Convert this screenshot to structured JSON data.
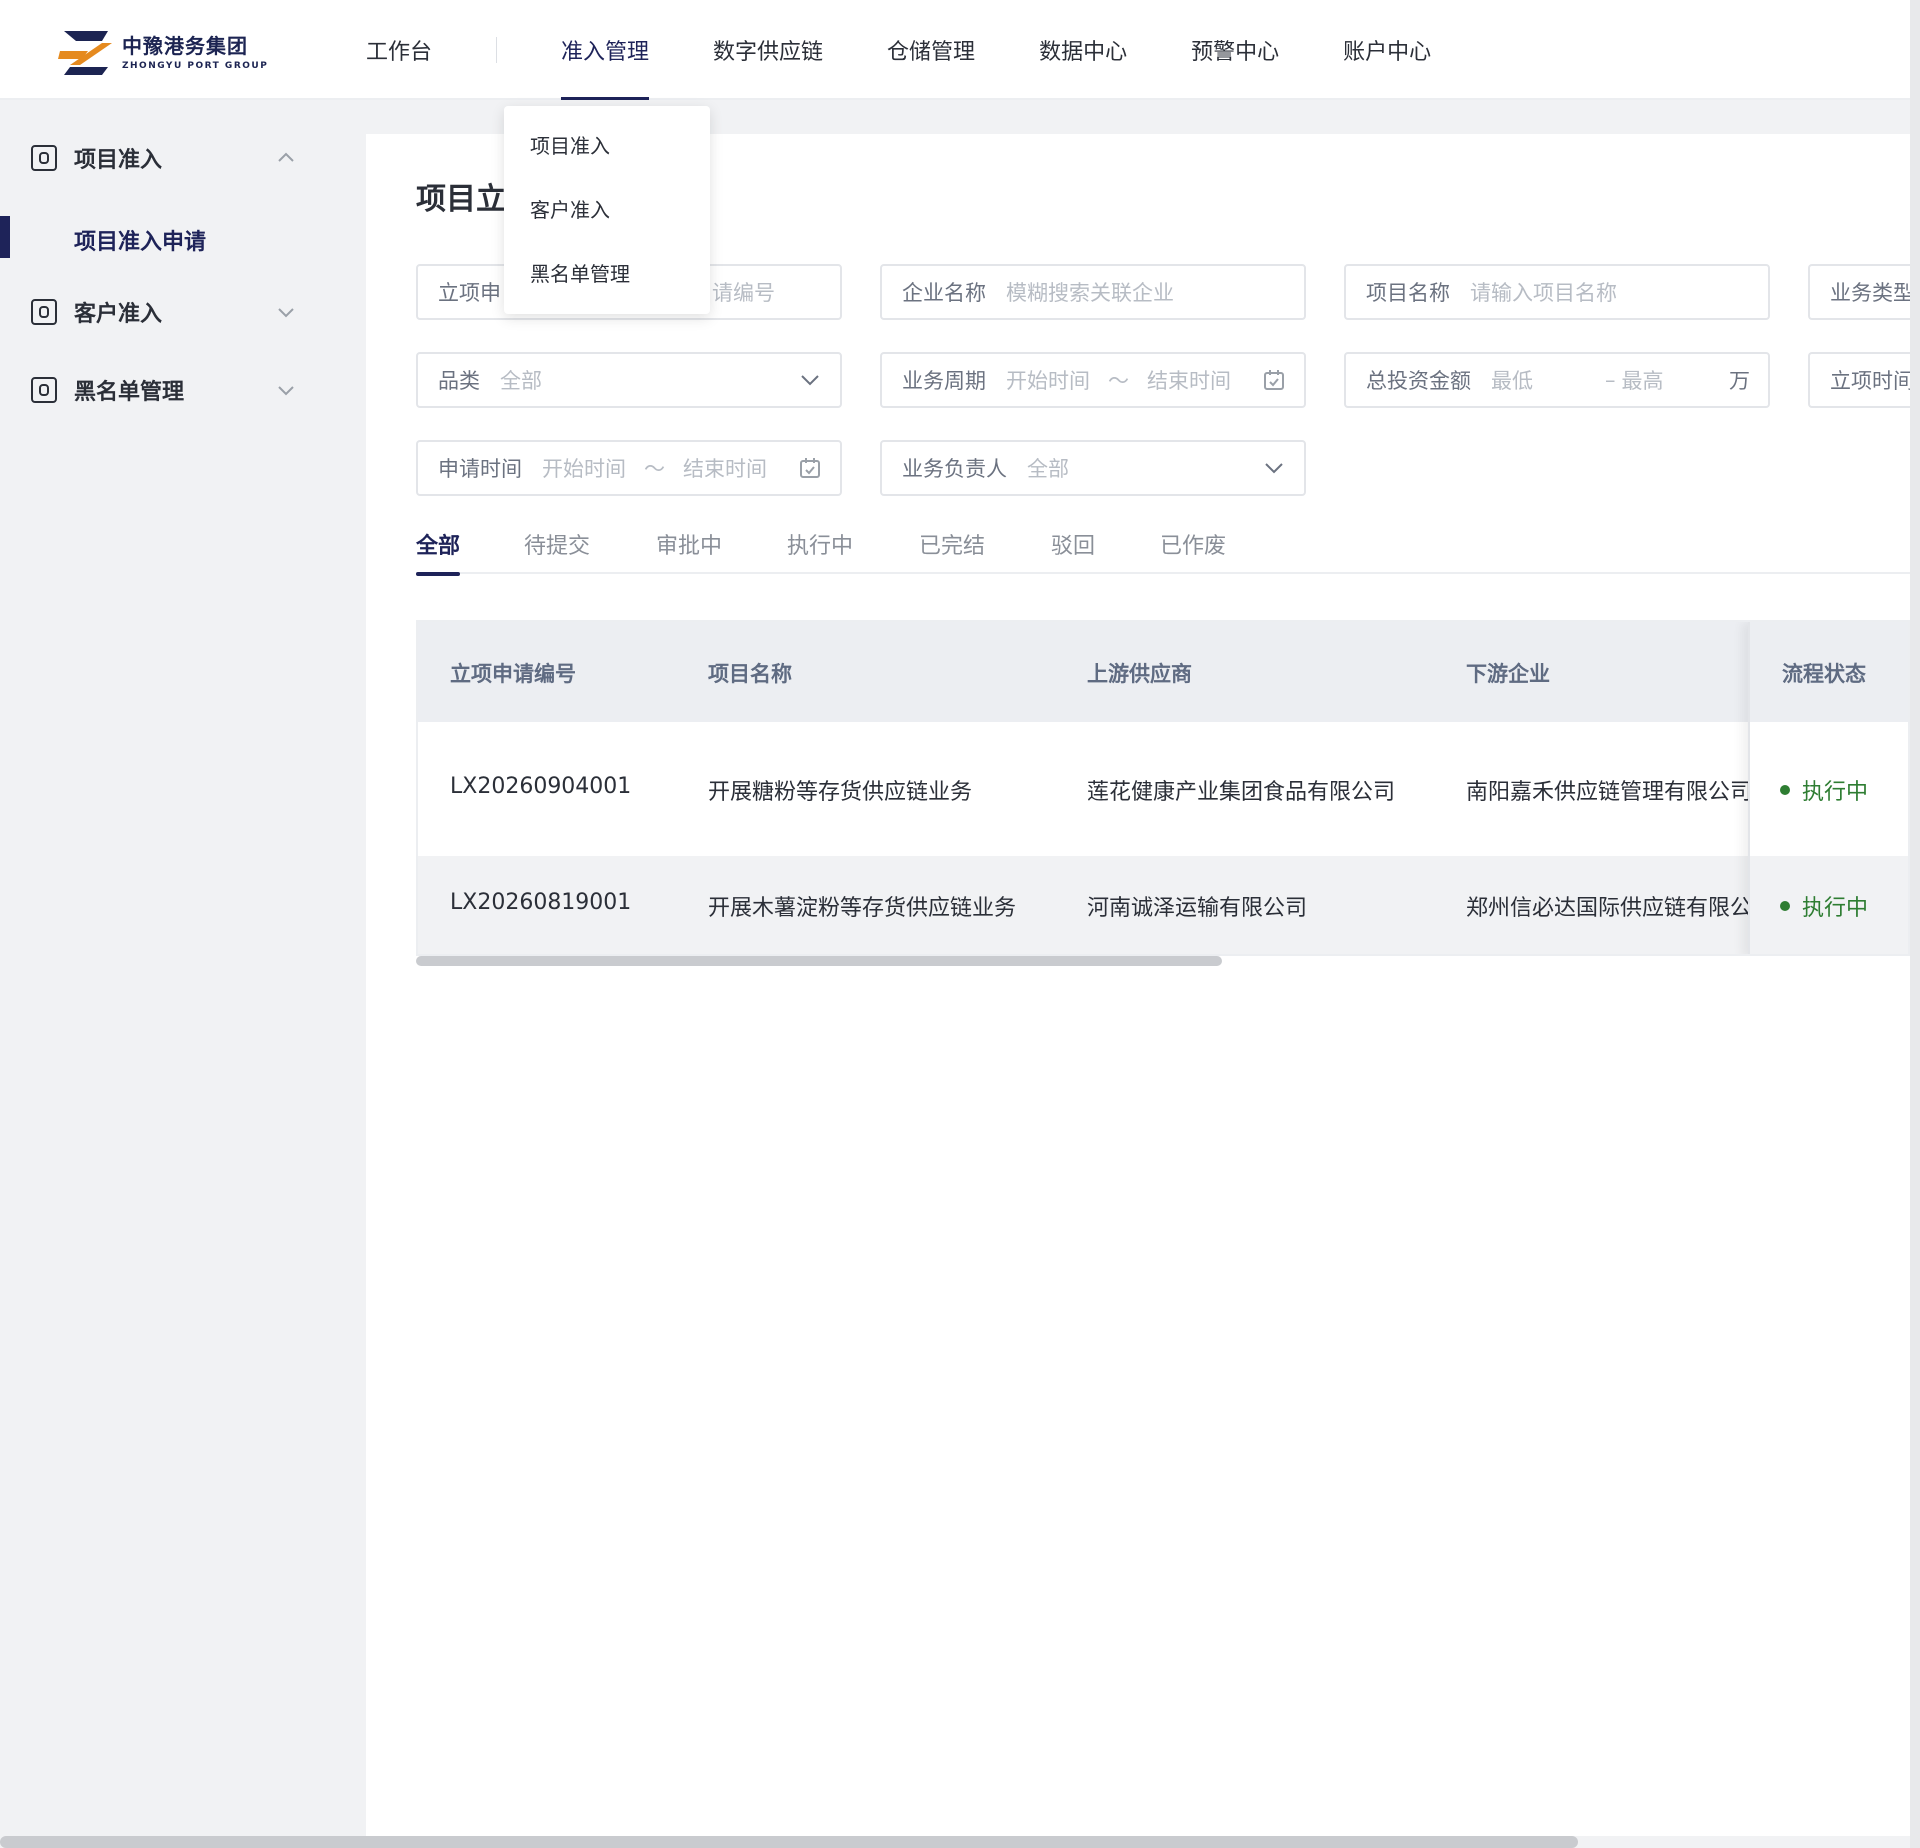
{
  "brand": {
    "name_cn": "中豫港务集团",
    "name_en": "ZHONGYU PORT GROUP"
  },
  "topnav": [
    {
      "label": "工作台"
    },
    {
      "label": "准入管理",
      "active": true
    },
    {
      "label": "数字供应链"
    },
    {
      "label": "仓储管理"
    },
    {
      "label": "数据中心"
    },
    {
      "label": "预警中心"
    },
    {
      "label": "账户中心"
    }
  ],
  "dropdown": {
    "items": [
      "项目准入",
      "客户准入",
      "黑名单管理"
    ]
  },
  "sidebar": {
    "groups": [
      {
        "label": "项目准入",
        "expanded": true,
        "icon": "lock-icon"
      },
      {
        "label": "客户准入",
        "expanded": false,
        "icon": "lock-icon"
      },
      {
        "label": "黑名单管理",
        "expanded": false,
        "icon": "lock-icon"
      }
    ],
    "active_sub": "项目准入申请"
  },
  "page": {
    "title_visible": "项目立"
  },
  "filters": {
    "apply_no": {
      "label": "立项申",
      "placeholder": "申请编号"
    },
    "company": {
      "label": "企业名称",
      "placeholder": "模糊搜索关联企业"
    },
    "project_name": {
      "label": "项目名称",
      "placeholder": "请输入项目名称"
    },
    "biz_type": {
      "label": "业务类型"
    },
    "category": {
      "label": "品类",
      "value": "全部"
    },
    "biz_period": {
      "label": "业务周期",
      "start": "开始时间",
      "sep": "～",
      "end": "结束时间"
    },
    "invest": {
      "label": "总投资金额",
      "min": "最低",
      "sep": "–",
      "max": "最高",
      "unit": "万"
    },
    "setup_time": {
      "label": "立项时间"
    },
    "apply_time": {
      "label": "申请时间",
      "start": "开始时间",
      "sep": "～",
      "end": "结束时间"
    },
    "owner": {
      "label": "业务负责人",
      "value": "全部"
    }
  },
  "tabs": [
    "全部",
    "待提交",
    "审批中",
    "执行中",
    "已完结",
    "驳回",
    "已作废"
  ],
  "table": {
    "headers": [
      "立项申请编号",
      "项目名称",
      "上游供应商",
      "下游企业",
      "流程状态"
    ],
    "rows": [
      {
        "no": "LX20260904001",
        "name": "开展糖粉等存货供应链业务",
        "upstream": "莲花健康产业集团食品有限公司",
        "downstream": "南阳嘉禾供应链管理有限公司",
        "status": "执行中"
      },
      {
        "no": "LX20260819001",
        "name": "开展木薯淀粉等存货供应链业务",
        "upstream": "河南诚泽运输有限公司",
        "downstream": "郑州信必达国际供应链有限公",
        "status": "执行中"
      }
    ]
  },
  "colors": {
    "primary": "#1e2359",
    "success": "#2e7d32",
    "muted": "#b7bcc4"
  }
}
